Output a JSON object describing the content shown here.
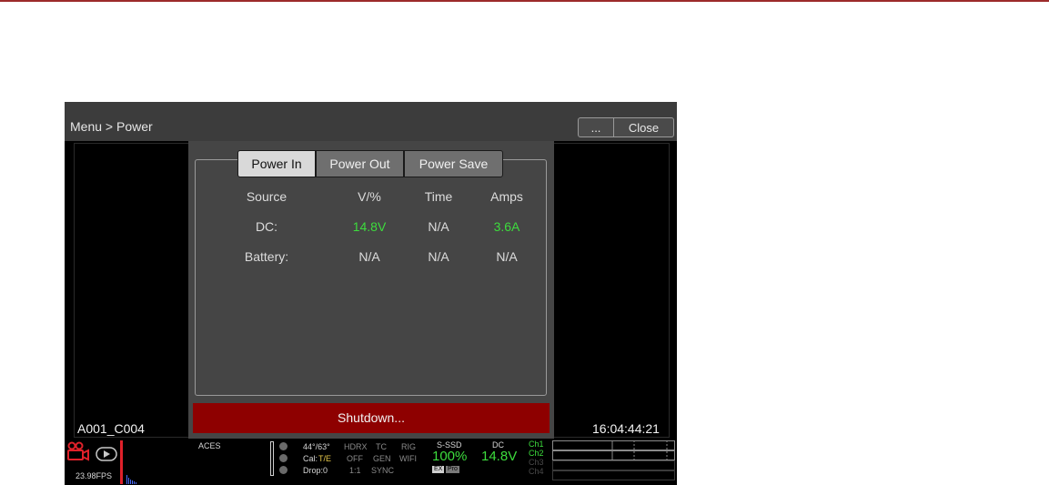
{
  "header": {
    "breadcrumb": "Menu > Power",
    "more_label": "...",
    "close_label": "Close"
  },
  "tabs": [
    {
      "label": "Power In",
      "active": true
    },
    {
      "label": "Power Out",
      "active": false
    },
    {
      "label": "Power Save",
      "active": false
    }
  ],
  "table": {
    "headers": [
      "Source",
      "V/%",
      "Time",
      "Amps"
    ],
    "rows": [
      {
        "source": "DC:",
        "volts": "14.8V",
        "time": "N/A",
        "amps": "3.6A"
      },
      {
        "source": "Battery:",
        "volts": "N/A",
        "time": "N/A",
        "amps": "N/A"
      }
    ]
  },
  "shutdown_label": "Shutdown...",
  "clip_name": "A001_C004",
  "timecode": "16:04:44:21",
  "status": {
    "fps": "23.98FPS",
    "color_space": "ACES",
    "temp": "44°/63°",
    "cal_label": "Cal:",
    "cal_value": "T/E",
    "drop": "Drop:0",
    "hdrx_label": "HDRX",
    "hdrx_value": "OFF",
    "ratio": "1:1",
    "tc_label": "TC",
    "tc_value": "GEN",
    "tc_sync": "SYNC",
    "rig_label": "RIG",
    "rig_value": "WIFI",
    "media_label": "S-SSD",
    "media_value": "100%",
    "media_tags": [
      "EX",
      "Pro"
    ],
    "dc_label": "DC",
    "dc_value": "14.8V",
    "channels": [
      "Ch1",
      "Ch2",
      "Ch3",
      "Ch4"
    ]
  },
  "colors": {
    "accent_red": "#8e0000",
    "value_green": "#3ddc3d",
    "panel": "#454545"
  },
  "icons": [
    "camera-icon",
    "play-icon"
  ]
}
